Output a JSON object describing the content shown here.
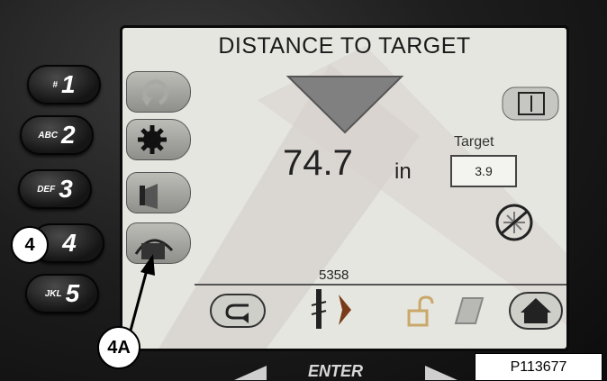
{
  "screen": {
    "title": "DISTANCE TO TARGET",
    "reading_value": "74.7",
    "reading_unit": "in",
    "target_label": "Target",
    "target_value": "3.9",
    "counter": "5358"
  },
  "keypad": [
    {
      "small": "#",
      "big": "1"
    },
    {
      "small": "ABC",
      "big": "2"
    },
    {
      "small": "DEF",
      "big": "3"
    },
    {
      "small": "",
      "big": "4"
    },
    {
      "small": "JKL",
      "big": "5"
    }
  ],
  "bezel": {
    "enter_label": "ENTER"
  },
  "callouts": {
    "key4": "4",
    "button4a": "4A"
  },
  "figure_id": "P113677",
  "icons": [
    "undo-icon",
    "gear-icon",
    "mast-icon",
    "retract-icon",
    "depth-range-icon",
    "laser-off-icon",
    "back-arrow-icon",
    "drill-icon",
    "next-chevron-icon",
    "unlock-icon",
    "note-icon",
    "home-icon"
  ],
  "colors": {
    "screen_bg": "#e6e6e0",
    "indicator_triangle": "#808080",
    "bezel": "#1a1a1a"
  }
}
